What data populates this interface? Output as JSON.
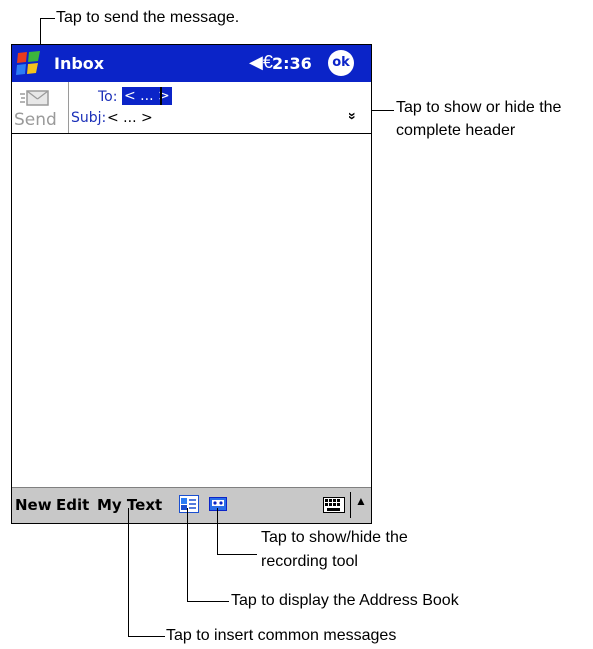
{
  "callouts": {
    "send": "Tap to send the message.",
    "header_toggle_line1": "Tap to show or hide the",
    "header_toggle_line2": "complete header",
    "recording_line1": "Tap to show/hide the",
    "recording_line2": "recording tool",
    "address_book": "Tap to display the Address Book",
    "my_text": "Tap to insert common messages"
  },
  "titlebar": {
    "title": "Inbox",
    "volume_icon": "◀€",
    "time": "2:36",
    "ok_label": "ok"
  },
  "header": {
    "send_label": "Send",
    "to_label": "To:",
    "to_value": "< ... >",
    "subject_label": "Subj:",
    "subject_value": "< ... >",
    "expander": "»"
  },
  "menubar": {
    "new": "New",
    "edit": "Edit",
    "my_text": "My Text",
    "sip_arrow": "▲"
  },
  "icons": {
    "start": "windows-flag-icon",
    "send": "envelope-icon",
    "address_book": "address-book-icon",
    "recording": "cassette-icon",
    "keyboard": "keyboard-icon"
  },
  "colors": {
    "titlebar": "#0b24c8",
    "field_label": "#1a2fb8",
    "menubar": "#c8c8c8",
    "disabled": "#9a9a9a"
  }
}
